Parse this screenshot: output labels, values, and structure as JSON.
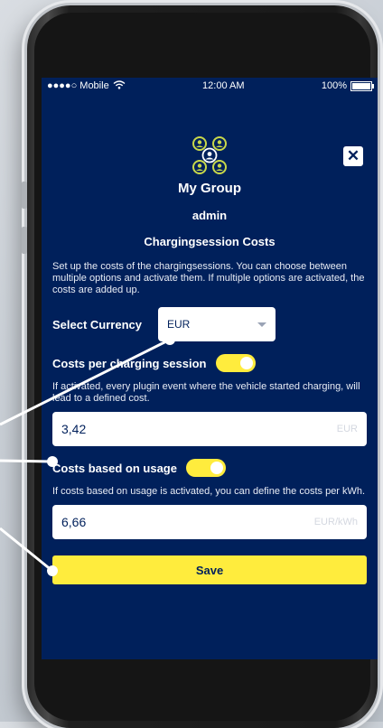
{
  "statusbar": {
    "carrier": "●●●●○ Mobile",
    "time": "12:00 AM",
    "battery": "100%"
  },
  "dialog": {
    "close_label": "✕",
    "group_name": "My Group",
    "role": "admin",
    "section_title": "Chargingsession Costs",
    "intro": "Set up the costs of the chargingsessions. You can choose between multiple options and activate them. If multiple options are activated, the costs are added up.",
    "currency": {
      "label": "Select Currency",
      "value": "EUR"
    },
    "per_session": {
      "label": "Costs per charging session",
      "enabled": true,
      "description": "If activated, every plugin event where the vehicle started charging, will lead to a defined cost.",
      "value": "3,42",
      "unit": "EUR"
    },
    "usage": {
      "label": "Costs based on usage",
      "enabled": true,
      "description": "If costs based on usage is activated, you can define the costs per kWh.",
      "value": "6,66",
      "unit": "EUR/kWh"
    },
    "save_label": "Save"
  },
  "colors": {
    "background": "#00205b",
    "accent": "#ffec3d",
    "icon": "#c8d84a"
  }
}
